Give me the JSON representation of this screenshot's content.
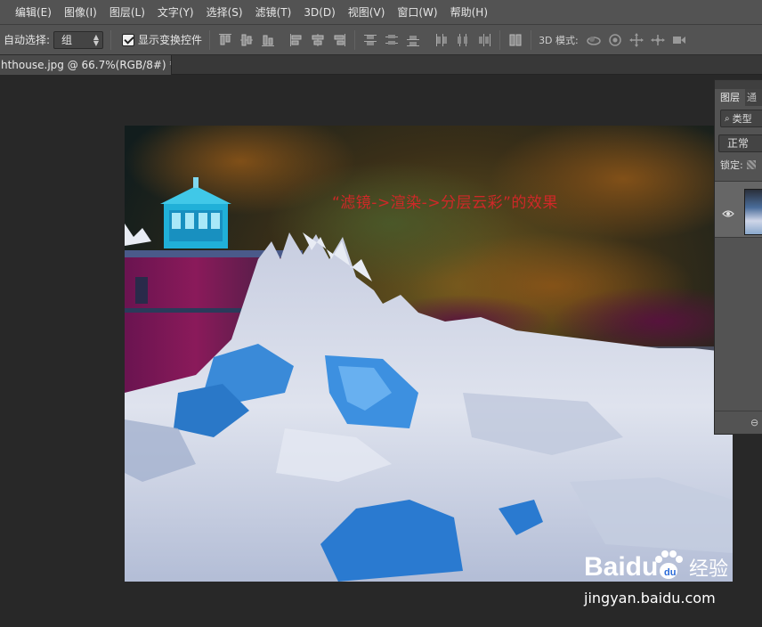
{
  "menu": {
    "items": [
      "编辑(E)",
      "图像(I)",
      "图层(L)",
      "文字(Y)",
      "选择(S)",
      "滤镜(T)",
      "3D(D)",
      "视图(V)",
      "窗口(W)",
      "帮助(H)"
    ]
  },
  "options": {
    "auto_select_label": "自动选择:",
    "auto_select_value": "组",
    "show_transform_label": "显示变换控件",
    "show_transform_checked": true,
    "mode_3d_label": "3D 模式:"
  },
  "document_tab": {
    "title": "hthouse.jpg @ 66.7%(RGB/8#) *",
    "close": "×"
  },
  "canvas": {
    "annotation": "“滤镜->渲染->分层云彩”的效果"
  },
  "layers_panel": {
    "tab_active": "图层",
    "tab_inactive": "通",
    "filter_label": "类型",
    "blend_mode": "正常",
    "lock_label": "锁定:",
    "link_icon_glyph": "⊖"
  },
  "watermark": {
    "brand": "Baidu",
    "brand_cn": "经验",
    "url": "jingyan.baidu.com"
  },
  "colors": {
    "menubar_bg": "#535353",
    "workspace_bg": "#282828",
    "annotation": "#d02828"
  }
}
